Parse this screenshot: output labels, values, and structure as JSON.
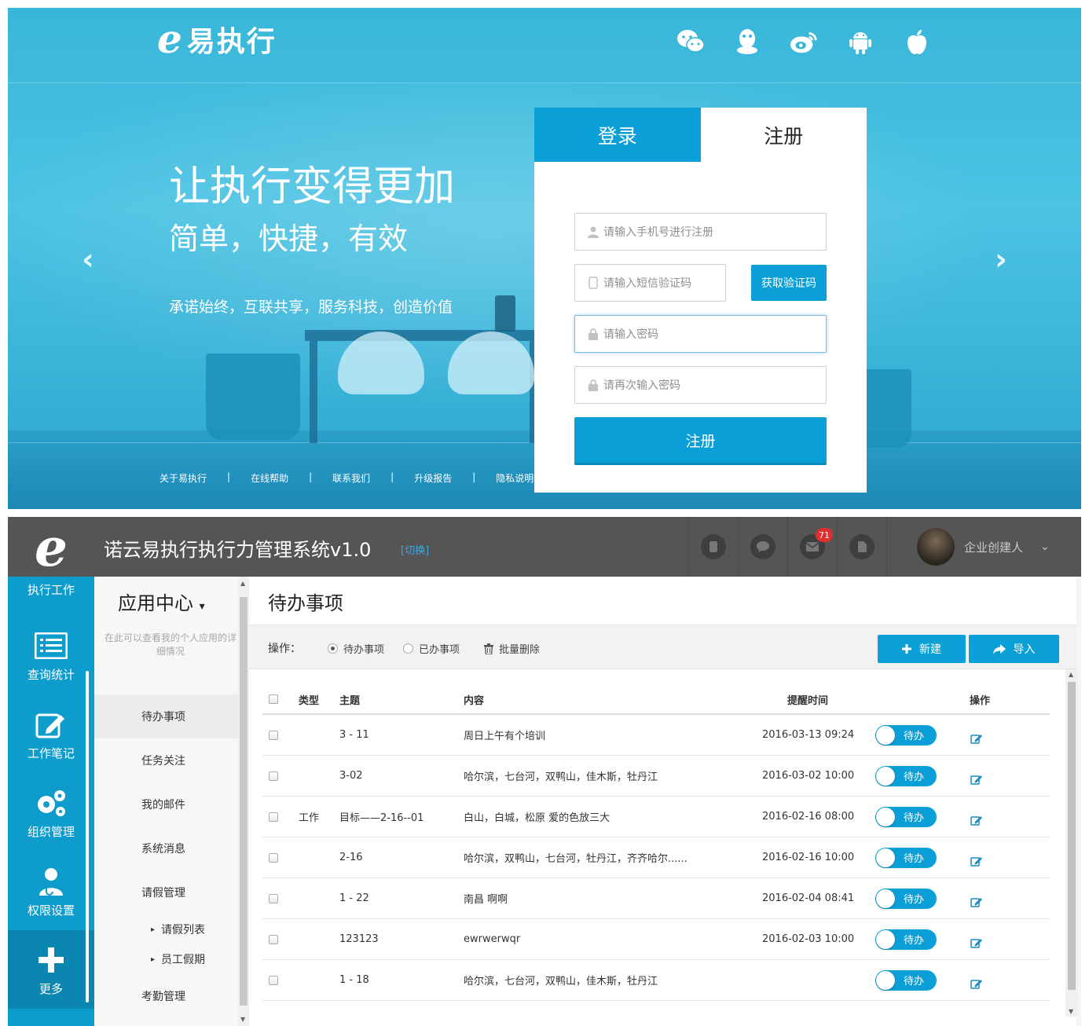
{
  "landing": {
    "brand_mark": "e",
    "brand_name": "易执行",
    "social_icons": [
      "wechat-icon",
      "qq-icon",
      "weibo-icon",
      "android-icon",
      "apple-icon"
    ],
    "hero_title": "让执行变得更加",
    "hero_sub": "简单，快捷，有效",
    "hero_slogan": "承诺始终，互联共享，服务科技，创造价值",
    "footer_links": [
      "关于易执行",
      "在线帮助",
      "联系我们",
      "升级报告",
      "隐私说明"
    ],
    "footer_separator": "|",
    "arrow_left": "‹",
    "arrow_right": "›",
    "tabs": {
      "login": "登录",
      "register": "注册"
    },
    "form": {
      "phone_placeholder": "请输入手机号进行注册",
      "sms_placeholder": "请输入短信验证码",
      "get_code_label": "获取验证码",
      "password_placeholder": "请输入密码",
      "password_confirm_placeholder": "请再次输入密码",
      "submit_label": "注册"
    },
    "colors": {
      "accent": "#0aa0d7",
      "background": "#4cc3e3"
    }
  },
  "app": {
    "logo_mark": "e",
    "title": "诺云易执行执行力管理系统v1.0",
    "switch_label": "[切换]",
    "topnav_icons": [
      "mobile-icon",
      "chat-icon",
      "mail-icon",
      "document-icon"
    ],
    "mail_badge": "71",
    "user_name": "企业创建人",
    "user_caret": "⌄",
    "leftnav": {
      "top_partial": "执行工作",
      "items": [
        {
          "label": "查询统计",
          "icon": "list-icon"
        },
        {
          "label": "工作笔记",
          "icon": "edit-note-icon"
        },
        {
          "label": "组织管理",
          "icon": "gears-icon"
        },
        {
          "label": "权限设置",
          "icon": "user-doctor-icon"
        },
        {
          "label": "更多",
          "icon": "plus-icon"
        }
      ]
    },
    "appcenter": {
      "title": "应用中心",
      "caret": "▾",
      "desc": "在此可以查看我的个人应用的详细情况",
      "menu": [
        "待办事项",
        "任务关注",
        "我的邮件",
        "系统消息",
        "请假管理"
      ],
      "submenu": [
        "请假列表",
        "员工假期"
      ],
      "tail": "考勤管理",
      "sub_marker": "▸"
    },
    "main": {
      "title": "待办事项",
      "op_label": "操作：",
      "radio_pending": "待办事项",
      "radio_done": "已办事项",
      "batch_delete": "批量删除",
      "new_label": "新建",
      "import_label": "导入",
      "columns": {
        "type": "类型",
        "subject": "主题",
        "content": "内容",
        "remind": "提醒时间",
        "action": "操作"
      },
      "status_label": "待办",
      "rows": [
        {
          "type": "",
          "subject": "3 - 11",
          "content": "周日上午有个培训",
          "remind": "2016-03-13 09:24"
        },
        {
          "type": "",
          "subject": "3-02",
          "content": "哈尔滨，七台河，双鸭山，佳木斯，牡丹江",
          "remind": "2016-03-02 10:00"
        },
        {
          "type": "工作",
          "subject": "目标——2-16--01",
          "content": "白山，白城，松原 爱的色放三大",
          "remind": "2016-02-16 08:00"
        },
        {
          "type": "",
          "subject": "2-16",
          "content": "哈尔滨，双鸭山，七台河，牡丹江，齐齐哈尔......",
          "remind": "2016-02-16 10:00"
        },
        {
          "type": "",
          "subject": "1 - 22",
          "content": "南昌 啊啊",
          "remind": "2016-02-04 08:41"
        },
        {
          "type": "",
          "subject": "123123",
          "content": "ewrwerwqr",
          "remind": "2016-02-03 10:00"
        },
        {
          "type": "",
          "subject": "1 - 18",
          "content": "哈尔滨，七台河，双鸭山，佳木斯，牡丹江",
          "remind": ""
        }
      ]
    },
    "scroll_up": "▲",
    "scroll_down": "▼",
    "colors": {
      "topbar": "#555555",
      "sidebar": "#0e9ccc",
      "accent": "#0aa0d7",
      "badge": "#e02f2f"
    }
  }
}
